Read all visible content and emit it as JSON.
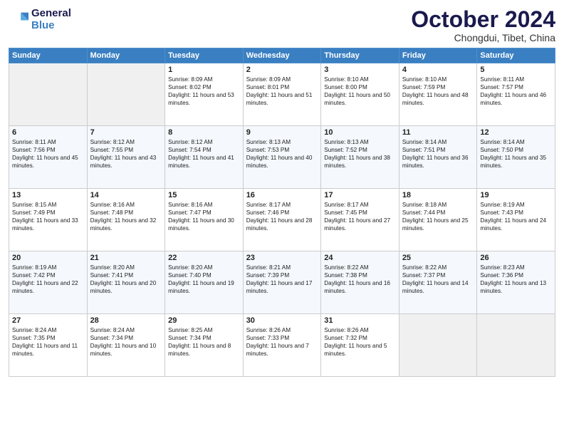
{
  "logo": {
    "line1": "General",
    "line2": "Blue"
  },
  "title": "October 2024",
  "location": "Chongdui, Tibet, China",
  "days_of_week": [
    "Sunday",
    "Monday",
    "Tuesday",
    "Wednesday",
    "Thursday",
    "Friday",
    "Saturday"
  ],
  "weeks": [
    [
      {
        "day": "",
        "text": ""
      },
      {
        "day": "",
        "text": ""
      },
      {
        "day": "1",
        "text": "Sunrise: 8:09 AM\nSunset: 8:02 PM\nDaylight: 11 hours and 53 minutes."
      },
      {
        "day": "2",
        "text": "Sunrise: 8:09 AM\nSunset: 8:01 PM\nDaylight: 11 hours and 51 minutes."
      },
      {
        "day": "3",
        "text": "Sunrise: 8:10 AM\nSunset: 8:00 PM\nDaylight: 11 hours and 50 minutes."
      },
      {
        "day": "4",
        "text": "Sunrise: 8:10 AM\nSunset: 7:59 PM\nDaylight: 11 hours and 48 minutes."
      },
      {
        "day": "5",
        "text": "Sunrise: 8:11 AM\nSunset: 7:57 PM\nDaylight: 11 hours and 46 minutes."
      }
    ],
    [
      {
        "day": "6",
        "text": "Sunrise: 8:11 AM\nSunset: 7:56 PM\nDaylight: 11 hours and 45 minutes."
      },
      {
        "day": "7",
        "text": "Sunrise: 8:12 AM\nSunset: 7:55 PM\nDaylight: 11 hours and 43 minutes."
      },
      {
        "day": "8",
        "text": "Sunrise: 8:12 AM\nSunset: 7:54 PM\nDaylight: 11 hours and 41 minutes."
      },
      {
        "day": "9",
        "text": "Sunrise: 8:13 AM\nSunset: 7:53 PM\nDaylight: 11 hours and 40 minutes."
      },
      {
        "day": "10",
        "text": "Sunrise: 8:13 AM\nSunset: 7:52 PM\nDaylight: 11 hours and 38 minutes."
      },
      {
        "day": "11",
        "text": "Sunrise: 8:14 AM\nSunset: 7:51 PM\nDaylight: 11 hours and 36 minutes."
      },
      {
        "day": "12",
        "text": "Sunrise: 8:14 AM\nSunset: 7:50 PM\nDaylight: 11 hours and 35 minutes."
      }
    ],
    [
      {
        "day": "13",
        "text": "Sunrise: 8:15 AM\nSunset: 7:49 PM\nDaylight: 11 hours and 33 minutes."
      },
      {
        "day": "14",
        "text": "Sunrise: 8:16 AM\nSunset: 7:48 PM\nDaylight: 11 hours and 32 minutes."
      },
      {
        "day": "15",
        "text": "Sunrise: 8:16 AM\nSunset: 7:47 PM\nDaylight: 11 hours and 30 minutes."
      },
      {
        "day": "16",
        "text": "Sunrise: 8:17 AM\nSunset: 7:46 PM\nDaylight: 11 hours and 28 minutes."
      },
      {
        "day": "17",
        "text": "Sunrise: 8:17 AM\nSunset: 7:45 PM\nDaylight: 11 hours and 27 minutes."
      },
      {
        "day": "18",
        "text": "Sunrise: 8:18 AM\nSunset: 7:44 PM\nDaylight: 11 hours and 25 minutes."
      },
      {
        "day": "19",
        "text": "Sunrise: 8:19 AM\nSunset: 7:43 PM\nDaylight: 11 hours and 24 minutes."
      }
    ],
    [
      {
        "day": "20",
        "text": "Sunrise: 8:19 AM\nSunset: 7:42 PM\nDaylight: 11 hours and 22 minutes."
      },
      {
        "day": "21",
        "text": "Sunrise: 8:20 AM\nSunset: 7:41 PM\nDaylight: 11 hours and 20 minutes."
      },
      {
        "day": "22",
        "text": "Sunrise: 8:20 AM\nSunset: 7:40 PM\nDaylight: 11 hours and 19 minutes."
      },
      {
        "day": "23",
        "text": "Sunrise: 8:21 AM\nSunset: 7:39 PM\nDaylight: 11 hours and 17 minutes."
      },
      {
        "day": "24",
        "text": "Sunrise: 8:22 AM\nSunset: 7:38 PM\nDaylight: 11 hours and 16 minutes."
      },
      {
        "day": "25",
        "text": "Sunrise: 8:22 AM\nSunset: 7:37 PM\nDaylight: 11 hours and 14 minutes."
      },
      {
        "day": "26",
        "text": "Sunrise: 8:23 AM\nSunset: 7:36 PM\nDaylight: 11 hours and 13 minutes."
      }
    ],
    [
      {
        "day": "27",
        "text": "Sunrise: 8:24 AM\nSunset: 7:35 PM\nDaylight: 11 hours and 11 minutes."
      },
      {
        "day": "28",
        "text": "Sunrise: 8:24 AM\nSunset: 7:34 PM\nDaylight: 11 hours and 10 minutes."
      },
      {
        "day": "29",
        "text": "Sunrise: 8:25 AM\nSunset: 7:34 PM\nDaylight: 11 hours and 8 minutes."
      },
      {
        "day": "30",
        "text": "Sunrise: 8:26 AM\nSunset: 7:33 PM\nDaylight: 11 hours and 7 minutes."
      },
      {
        "day": "31",
        "text": "Sunrise: 8:26 AM\nSunset: 7:32 PM\nDaylight: 11 hours and 5 minutes."
      },
      {
        "day": "",
        "text": ""
      },
      {
        "day": "",
        "text": ""
      }
    ]
  ]
}
